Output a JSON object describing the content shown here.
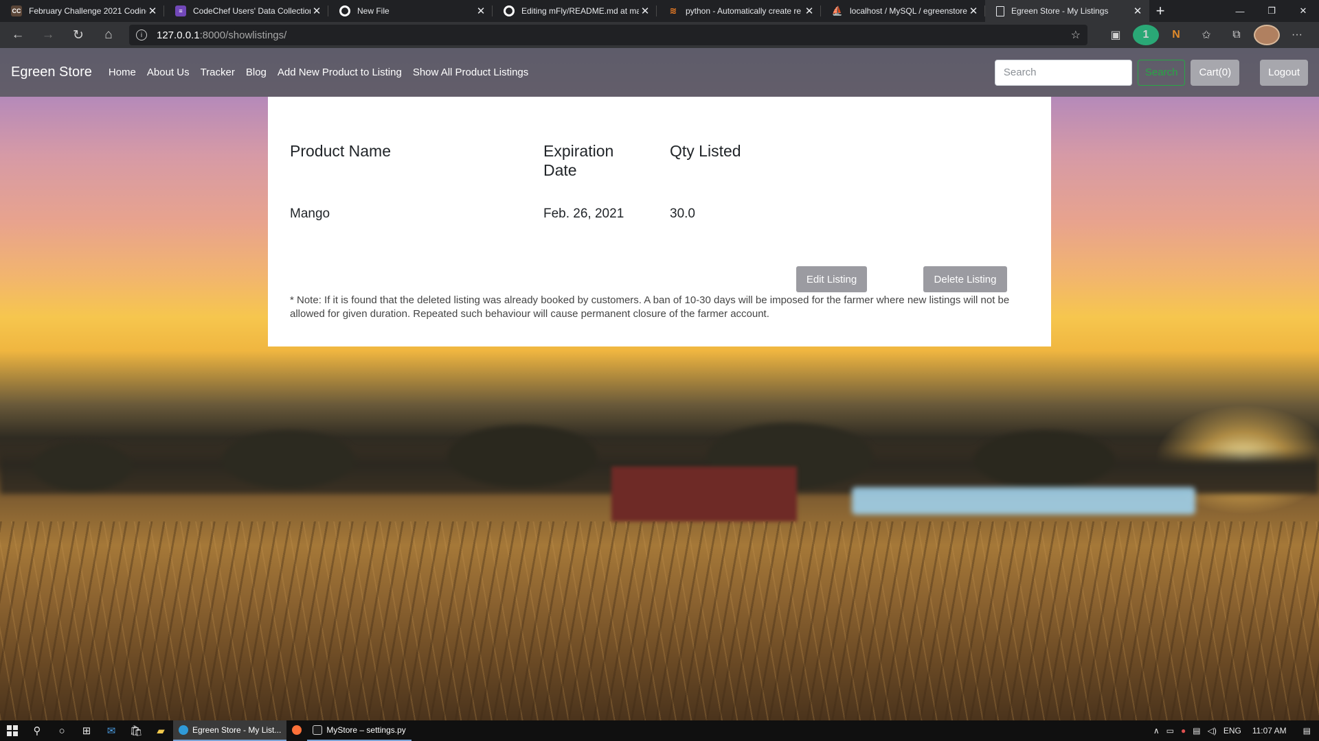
{
  "browser": {
    "tabs": [
      {
        "title": "February Challenge 2021 Coding",
        "icon": "codechef-icon",
        "color": "#5b4638",
        "active": false
      },
      {
        "title": "CodeChef Users' Data Collection",
        "icon": "forms-icon",
        "color": "#7248b9",
        "active": false
      },
      {
        "title": "New File",
        "icon": "github-icon",
        "color": "#ffffff",
        "active": false
      },
      {
        "title": "Editing mFly/README.md at ma",
        "icon": "github-icon",
        "color": "#ffffff",
        "active": false
      },
      {
        "title": "python - Automatically create re",
        "icon": "stackoverflow-icon",
        "color": "#f48024",
        "active": false
      },
      {
        "title": "localhost / MySQL / egreenstore",
        "icon": "phpmyadmin-icon",
        "color": "#f0a030",
        "active": false
      },
      {
        "title": "Egreen Store - My Listings",
        "icon": "page-icon",
        "color": "#e8eaed",
        "active": true
      }
    ],
    "url_host": "127.0.0.1",
    "url_path": ":8000/showlistings/",
    "ext_badge": "1"
  },
  "site": {
    "brand": "Egreen Store",
    "nav_links": [
      "Home",
      "About Us",
      "Tracker",
      "Blog",
      "Add New Product to Listing",
      "Show All Product Listings"
    ],
    "search_placeholder": "Search",
    "search_button": "Search",
    "cart_button": "Cart(0)",
    "logout_button": "Logout",
    "accent_green": "#28a745"
  },
  "listings": {
    "headers": {
      "product_name": "Product Name",
      "expiration_date": "Expiration Date",
      "qty_listed": "Qty Listed"
    },
    "rows": [
      {
        "product_name": "Mango",
        "expiration_date": "Feb. 26, 2021",
        "qty_listed": "30.0",
        "edit_label": "Edit Listing",
        "delete_label": "Delete Listing"
      }
    ],
    "note": "* Note: If it is found that the deleted listing was already booked by customers. A ban of 10-30 days will be imposed for the farmer where new listings will not be allowed for given duration. Repeated such behaviour will cause permanent closure of the farmer account."
  },
  "taskbar": {
    "apps": [
      {
        "title": "Egreen Store - My List...",
        "icon": "edge-icon",
        "state": "active"
      },
      {
        "title": "",
        "icon": "firefox-icon",
        "state": "normal"
      },
      {
        "title": "MyStore – settings.py",
        "icon": "pycharm-icon",
        "state": "open"
      }
    ],
    "language": "ENG",
    "time": "11:07 AM"
  }
}
